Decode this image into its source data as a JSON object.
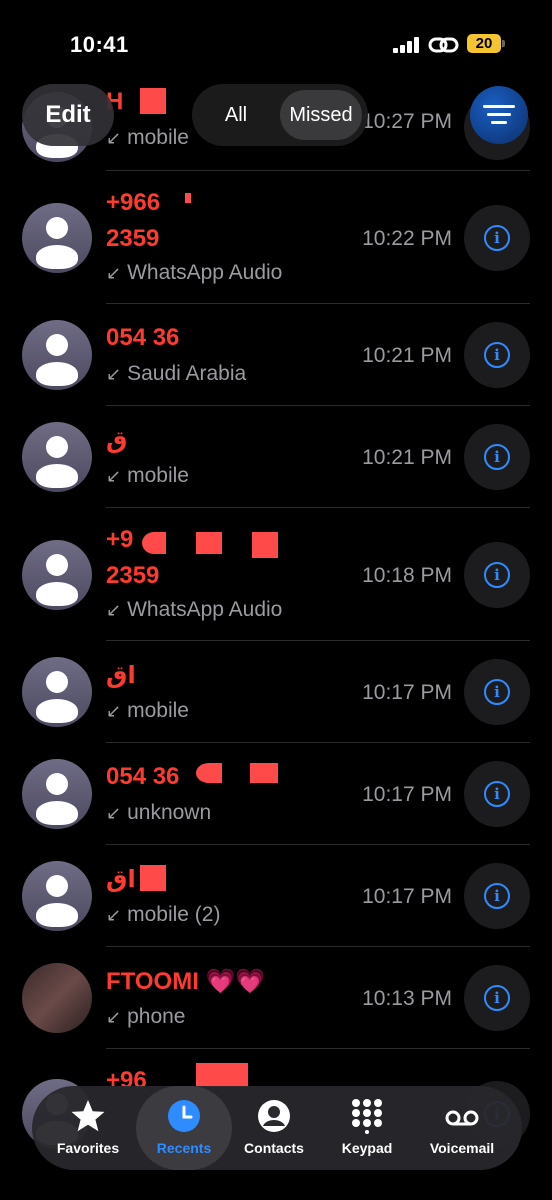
{
  "status": {
    "time": "10:41",
    "battery": "20"
  },
  "toolbar": {
    "edit": "Edit",
    "segments": [
      "All",
      "Missed"
    ]
  },
  "calls": [
    {
      "name": "H",
      "sub": "mobile",
      "time": "10:27 PM"
    },
    {
      "name_line1": "+966",
      "name_line2": "2359",
      "sub": "WhatsApp Audio",
      "time": "10:22 PM"
    },
    {
      "name": "054 36",
      "sub": "Saudi Arabia",
      "time": "10:21 PM"
    },
    {
      "name": "ق",
      "sub": "mobile",
      "time": "10:21 PM"
    },
    {
      "name_line1": "+9",
      "name_line2": "2359",
      "sub": "WhatsApp Audio",
      "time": "10:18 PM"
    },
    {
      "name": "اق",
      "sub": "mobile",
      "time": "10:17 PM"
    },
    {
      "name": "054 36",
      "sub": "unknown",
      "time": "10:17 PM"
    },
    {
      "name": "اق",
      "sub": "mobile (2)",
      "time": "10:17 PM"
    },
    {
      "name": "FTOOMI 💗💗",
      "sub": "phone",
      "time": "10:13 PM"
    },
    {
      "name": "+96",
      "sub": "",
      "time": ""
    }
  ],
  "tabs": [
    {
      "label": "Favorites",
      "icon": "star-icon"
    },
    {
      "label": "Recents",
      "icon": "clock-icon",
      "active": true
    },
    {
      "label": "Contacts",
      "icon": "person-circle-icon"
    },
    {
      "label": "Keypad",
      "icon": "keypad-icon"
    },
    {
      "label": "Voicemail",
      "icon": "voicemail-icon"
    }
  ],
  "colors": {
    "missed": "#ff3b30",
    "accent": "#2f8cff",
    "secondary": "#9a9aa0"
  }
}
